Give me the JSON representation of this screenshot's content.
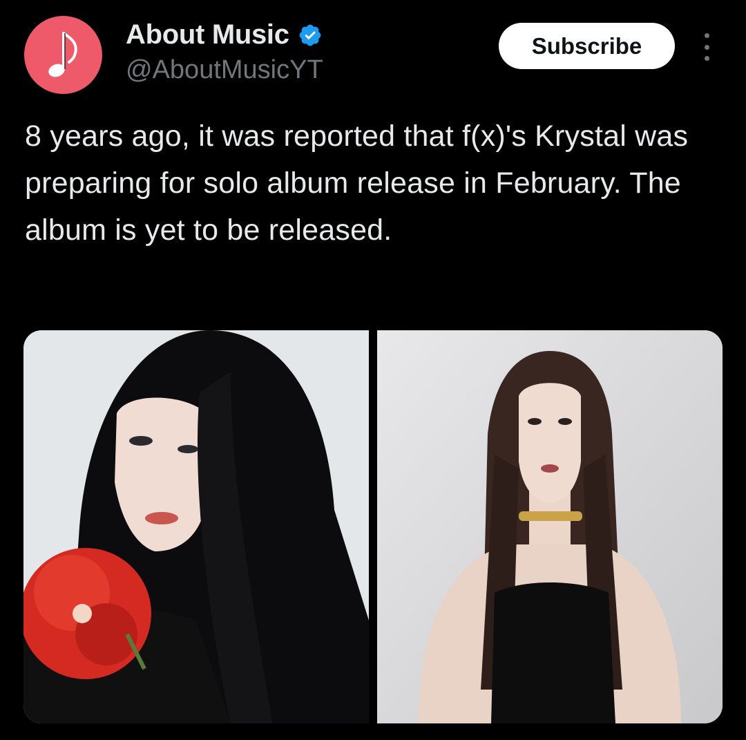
{
  "account": {
    "display_name": "About Music",
    "handle": "@AboutMusicYT",
    "verified": true,
    "avatar_icon": "music-note-icon",
    "avatar_color": "#ef5a6a",
    "verified_color": "#1d9bf0"
  },
  "actions": {
    "subscribe_label": "Subscribe",
    "more_icon": "vertical-ellipsis-icon"
  },
  "tweet": {
    "text": "8 years ago, it was reported that f(x)'s Krystal was preparing for solo album release in February. The album is yet to be released."
  },
  "media": [
    {
      "kind": "photo",
      "subject": "portrait-with-red-flower"
    },
    {
      "kind": "photo",
      "subject": "portrait-black-dress"
    }
  ]
}
